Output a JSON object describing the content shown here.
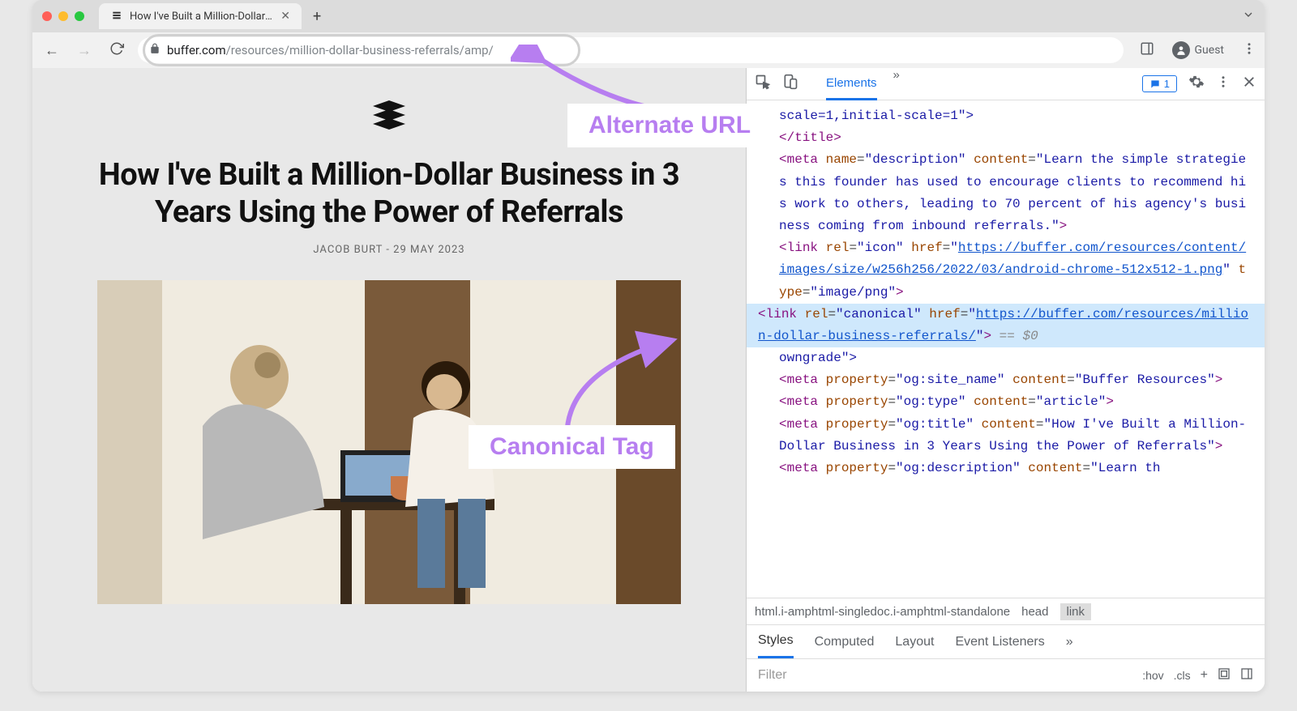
{
  "browser": {
    "tab_title": "How I've Built a Million-Dollar B",
    "url_domain": "buffer.com",
    "url_path": "/resources/million-dollar-business-referrals/amp/",
    "guest_label": "Guest"
  },
  "article": {
    "title": "How I've Built a Million-Dollar Business in 3 Years Using the Power of Referrals",
    "byline": "JACOB BURT - 29 MAY 2023"
  },
  "annotations": {
    "alternate": "Alternate URL",
    "canonical": "Canonical Tag"
  },
  "devtools": {
    "tab_elements": "Elements",
    "issues_count": "1",
    "meta_viewport_tail": "scale=1,initial-scale=1\">",
    "close_title": "</title>",
    "meta_desc_open": "<meta name=\"description\" content=\"",
    "meta_desc_text": "Learn the simple strategies this founder has used to encourage clients to recommend his work to others, leading to 70 percent of his agency's business coming from inbound referrals.",
    "link_icon_open": "<link rel=\"icon\" href=\"",
    "link_icon_href": "https://buffer.com/resources/content/images/size/w256h256/2022/03/android-chrome-512x512-1.png",
    "link_icon_tail": "\" type=\"image/png\">",
    "canonical_open": "<link rel=",
    "canonical_rel": "canonical",
    "canonical_mid": " href=\"",
    "canonical_href": "https://buffer.com/resources/million-dollar-business-referrals/",
    "canonical_close": "\"> ",
    "selected_marker": "== $0",
    "owndowngrade_tail": "owngrade\">",
    "og_sitename": "<meta property=\"og:site_name\" content=\"Buffer Resources\">",
    "og_type": "<meta property=\"og:type\" content=\"article\">",
    "og_title": "<meta property=\"og:title\" content=\"How I've Built a Million-Dollar Business in 3 Years Using the Power of Referrals\">",
    "og_desc_partial": "<meta property=\"og:description\" content=\"Learn th",
    "breadcrumb1": "html.i-amphtml-singledoc.i-amphtml-standalone",
    "breadcrumb2": "head",
    "breadcrumb3": "link",
    "styles_tab": "Styles",
    "computed_tab": "Computed",
    "layout_tab": "Layout",
    "events_tab": "Event Listeners",
    "filter_placeholder": "Filter",
    "hov_label": ":hov",
    "cls_label": ".cls"
  }
}
